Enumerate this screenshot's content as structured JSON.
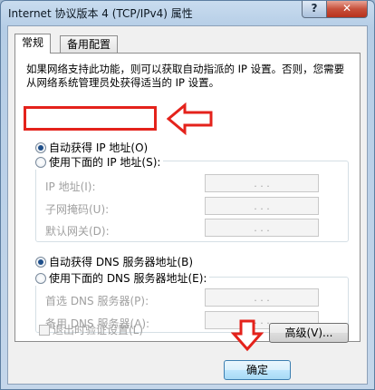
{
  "window": {
    "title": "Internet 协议版本 4 (TCP/IPv4) 属性",
    "help_button": "?",
    "close_button": "✕"
  },
  "tabs": [
    {
      "label": "常规",
      "active": true
    },
    {
      "label": "备用配置",
      "active": false
    }
  ],
  "description": "如果网络支持此功能，则可以获取自动指派的 IP 设置。否则，您需要从网络系统管理员处获得适当的 IP 设置。",
  "ip_section": {
    "auto_label": "自动获得 IP 地址(O)",
    "auto_selected": true,
    "manual_label": "使用下面的 IP 地址(S):",
    "fields": [
      {
        "label": "IP 地址(I):",
        "value": ". . ."
      },
      {
        "label": "子网掩码(U):",
        "value": ". . ."
      },
      {
        "label": "默认网关(D):",
        "value": ". . ."
      }
    ]
  },
  "dns_section": {
    "auto_label": "自动获得 DNS 服务器地址(B)",
    "auto_selected": true,
    "manual_label": "使用下面的 DNS 服务器地址(E):",
    "fields": [
      {
        "label": "首选 DNS 服务器(P):",
        "value": ". . ."
      },
      {
        "label": "备用 DNS 服务器(A):",
        "value": ". . ."
      }
    ]
  },
  "validate_checkbox": {
    "label": "退出时验证设置(L)",
    "checked": false
  },
  "buttons": {
    "advanced": "高级(V)...",
    "ok": "确定"
  },
  "annotation_color": "#e4221b"
}
